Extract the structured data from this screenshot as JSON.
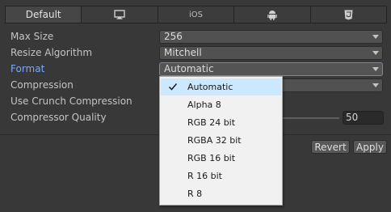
{
  "tabs": [
    {
      "label": "Default",
      "icon": null
    },
    {
      "label": "",
      "icon": "monitor-icon"
    },
    {
      "label": "iOS",
      "icon": null
    },
    {
      "label": "",
      "icon": "android-icon"
    },
    {
      "label": "",
      "icon": "html5-icon"
    }
  ],
  "fields": {
    "max_size": {
      "label": "Max Size",
      "value": "256"
    },
    "resize_algorithm": {
      "label": "Resize Algorithm",
      "value": "Mitchell"
    },
    "format": {
      "label": "Format",
      "value": "Automatic"
    },
    "compression": {
      "label": "Compression"
    },
    "use_crunch": {
      "label": "Use Crunch Compression"
    },
    "compressor_quality": {
      "label": "Compressor Quality",
      "value": "50"
    }
  },
  "buttons": {
    "revert": "Revert",
    "apply": "Apply"
  },
  "format_menu": {
    "selected": "Automatic",
    "options": [
      "Automatic",
      "Alpha 8",
      "RGB 24 bit",
      "RGBA 32 bit",
      "RGB 16 bit",
      "R 16 bit",
      "R 8"
    ]
  },
  "colors": {
    "background": "#383838",
    "accent": "#5f8dd3",
    "menu_bg": "#f1f1f1",
    "menu_selected": "#cce8ff"
  }
}
